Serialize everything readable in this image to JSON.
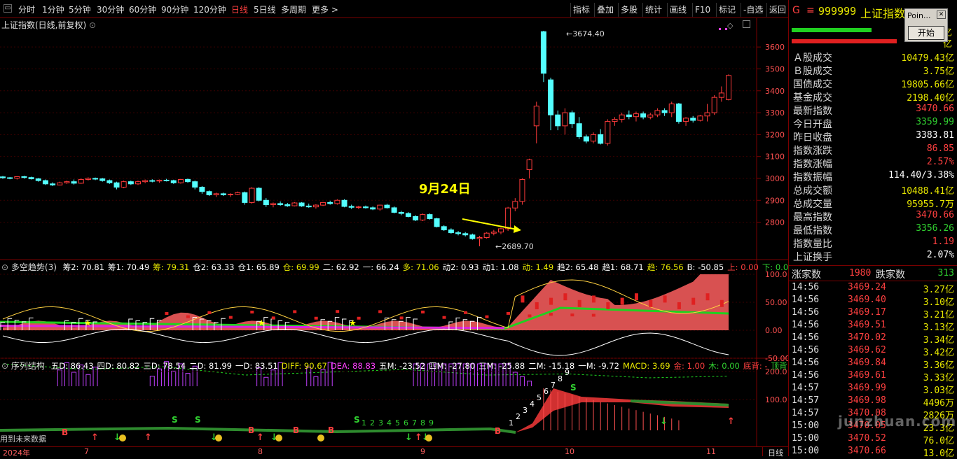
{
  "topbar": {
    "periods": [
      "分时",
      "1分钟",
      "5分钟",
      "30分钟",
      "60分钟",
      "90分钟",
      "120分钟",
      "日线",
      "5日线",
      "多周期",
      "更多 >"
    ],
    "active": "日线",
    "right_buttons": [
      "指标",
      "叠加",
      "多股",
      "统计",
      "画线",
      "F10",
      "标记",
      "-自选",
      "返回"
    ]
  },
  "main_panel": {
    "title": "上证指数(日线,前复权)",
    "high_label": "3674.40",
    "low_label": "2689.70",
    "annotation": "9月24日",
    "y_ticks": [
      "3600",
      "3500",
      "3400",
      "3300",
      "3200",
      "3100",
      "3000",
      "2900",
      "2800"
    ]
  },
  "panel2": {
    "title": "多空趋势(3)",
    "values": [
      {
        "t": "筹2: 70.81",
        "c": "#ffffff"
      },
      {
        "t": "筹1: 70.49",
        "c": "#ffffff"
      },
      {
        "t": "筹: 79.31",
        "c": "#e8e800"
      },
      {
        "t": "仓2: 63.33",
        "c": "#ffffff"
      },
      {
        "t": "仓1: 65.89",
        "c": "#ffffff"
      },
      {
        "t": "仓: 69.99",
        "c": "#e8e800"
      },
      {
        "t": "二: 62.92",
        "c": "#ffffff"
      },
      {
        "t": "一: 66.24",
        "c": "#ffffff"
      },
      {
        "t": "多: 71.06",
        "c": "#e8e800"
      },
      {
        "t": "动2: 0.93",
        "c": "#ffffff"
      },
      {
        "t": "动1: 1.08",
        "c": "#ffffff"
      },
      {
        "t": "动: 1.49",
        "c": "#e8e800"
      },
      {
        "t": "趋2: 65.48",
        "c": "#ffffff"
      },
      {
        "t": "趋1: 68.71",
        "c": "#ffffff"
      },
      {
        "t": "趋: 76.56",
        "c": "#e8e800"
      },
      {
        "t": "B: -50.85",
        "c": "#ffffff"
      },
      {
        "t": "上: 0.00",
        "c": "#ff4040"
      },
      {
        "t": "下: 0.00",
        "c": "#30d030"
      }
    ],
    "y_ticks": [
      "100.0",
      "50.00",
      "0.00",
      "-50.00"
    ]
  },
  "panel3": {
    "title": "序列结构",
    "values": [
      {
        "t": "五D: 86.43",
        "c": "#ffffff"
      },
      {
        "t": "四D: 80.82",
        "c": "#ffffff"
      },
      {
        "t": "三D: 78.54",
        "c": "#ffffff"
      },
      {
        "t": "二D: 81.99",
        "c": "#ffffff"
      },
      {
        "t": "一D: 83.51",
        "c": "#ffffff"
      },
      {
        "t": "DIFF: 90.67",
        "c": "#e8e800"
      },
      {
        "t": "DEA: 88.83",
        "c": "#ff40ff"
      },
      {
        "t": "五M: -23.52",
        "c": "#ffffff"
      },
      {
        "t": "四M: -27.80",
        "c": "#ffffff"
      },
      {
        "t": "三M: -25.88",
        "c": "#ffffff"
      },
      {
        "t": "二M: -15.18",
        "c": "#ffffff"
      },
      {
        "t": "一M: -9.72",
        "c": "#ffffff"
      },
      {
        "t": "MACD: 3.69",
        "c": "#e8e800"
      },
      {
        "t": "金: 1.00",
        "c": "#ff4040"
      },
      {
        "t": "木: 0.00",
        "c": "#30d030"
      },
      {
        "t": "底背: -",
        "c": "#ff4040"
      },
      {
        "t": "顶背",
        "c": "#30d030"
      }
    ],
    "y_ticks": [
      "200.0",
      "100.0"
    ],
    "seq_digits": "1 2 3 4 5 6 7 8 9",
    "footnote": "用到未来数据"
  },
  "timeline": {
    "labels": [
      {
        "t": "2024年",
        "x": 4
      },
      {
        "t": "7",
        "x": 120
      },
      {
        "t": "8",
        "x": 368
      },
      {
        "t": "9",
        "x": 600
      },
      {
        "t": "10",
        "x": 806
      },
      {
        "t": "11",
        "x": 1008
      }
    ],
    "right": "日线"
  },
  "quote": {
    "code": "999999",
    "name": "上证指数",
    "prefix": "G",
    "menu": "≡",
    "rows": [
      {
        "label": "Ａ股成交",
        "value": "10479.43亿",
        "color": "#e8e800"
      },
      {
        "label": "Ｂ股成交",
        "value": "3.75亿",
        "color": "#e8e800"
      },
      {
        "label": "国债成交",
        "value": "19805.66亿",
        "color": "#e8e800"
      },
      {
        "label": "基金成交",
        "value": "2198.40亿",
        "color": "#e8e800"
      },
      {
        "label": "最新指数",
        "value": "3470.66",
        "color": "#ff4040"
      },
      {
        "label": "今日开盘",
        "value": "3359.99",
        "color": "#30d030"
      },
      {
        "label": "昨日收盘",
        "value": "3383.81",
        "color": "#ffffff"
      },
      {
        "label": "指数涨跌",
        "value": "86.85",
        "color": "#ff4040"
      },
      {
        "label": "指数涨幅",
        "value": "2.57%",
        "color": "#ff4040"
      },
      {
        "label": "指数振幅",
        "value": "114.40/3.38%",
        "color": "#ffffff"
      },
      {
        "label": "总成交额",
        "value": "10488.41亿",
        "color": "#e8e800"
      },
      {
        "label": "总成交量",
        "value": "95955.7万",
        "color": "#e8e800"
      },
      {
        "label": "最高指数",
        "value": "3470.66",
        "color": "#ff4040"
      },
      {
        "label": "最低指数",
        "value": "3356.26",
        "color": "#30d030"
      },
      {
        "label": "指数量比",
        "value": "1.19",
        "color": "#ff4040"
      },
      {
        "label": "上证换手",
        "value": "2.07%",
        "color": "#ffffff"
      }
    ],
    "top_right_vals": [
      "亿",
      "亿"
    ],
    "up_label": "涨家数",
    "up_count": "1980",
    "down_label": "跌家数",
    "down_count": "313"
  },
  "ticks": [
    {
      "t": "14:56",
      "p": "3469.24",
      "v": "3.27亿"
    },
    {
      "t": "14:56",
      "p": "3469.40",
      "v": "3.10亿"
    },
    {
      "t": "14:56",
      "p": "3469.17",
      "v": "3.21亿"
    },
    {
      "t": "14:56",
      "p": "3469.51",
      "v": "3.13亿"
    },
    {
      "t": "14:56",
      "p": "3470.02",
      "v": "3.34亿"
    },
    {
      "t": "14:56",
      "p": "3469.62",
      "v": "3.42亿"
    },
    {
      "t": "14:56",
      "p": "3469.84",
      "v": "3.36亿"
    },
    {
      "t": "14:56",
      "p": "3469.61",
      "v": "3.33亿"
    },
    {
      "t": "14:57",
      "p": "3469.99",
      "v": "3.03亿"
    },
    {
      "t": "14:57",
      "p": "3469.98",
      "v": "4496万"
    },
    {
      "t": "14:57",
      "p": "3470.08",
      "v": "2826万"
    },
    {
      "t": "15:00",
      "p": "3470.05",
      "v": "23.3亿"
    },
    {
      "t": "15:00",
      "p": "3470.52",
      "v": "76.0亿"
    },
    {
      "t": "15:00",
      "p": "3470.66",
      "v": "13.0亿"
    }
  ],
  "popup": {
    "title": "Poin...",
    "button": "开始"
  },
  "watermark": "junzhuan.com",
  "colors": {
    "up": "#ff3b3b",
    "down": "#54ffff",
    "panel_border": "#7a0000"
  }
}
